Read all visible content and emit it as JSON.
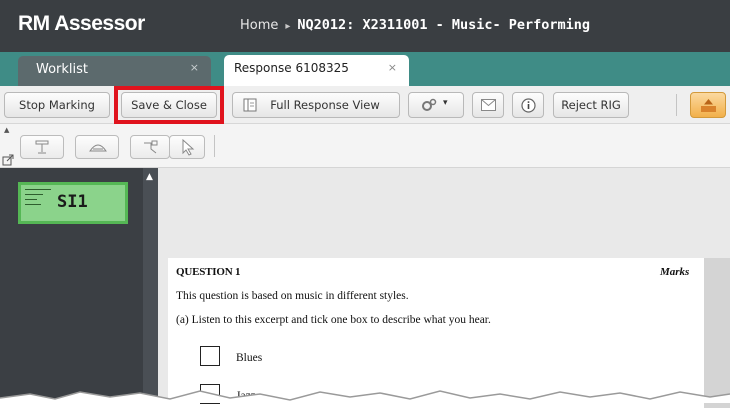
{
  "app": {
    "brand": "RM Assessor"
  },
  "breadcrumb": {
    "home": "Home",
    "separator": "▸",
    "current": "NQ2012: X2311001 - Music- Performing"
  },
  "tabs": [
    {
      "label": "Worklist",
      "close": "×"
    },
    {
      "label": "Response 6108325",
      "close": "×"
    }
  ],
  "toolbar": {
    "stop_marking": "Stop Marking",
    "save_close": "Save & Close",
    "full_response_view": "Full Response View",
    "settings_caret": "▾",
    "reject_rig": "Reject RIG"
  },
  "left_panel": {
    "thumbnail_label": "SI1",
    "scroll_up": "▲"
  },
  "document": {
    "question_title": "QUESTION 1",
    "marks_label": "Marks",
    "intro": "This question is based on music in different styles.",
    "part_a": "(a)  Listen to this excerpt and tick one box to describe what you hear.",
    "options": [
      "Blues",
      "Jazz"
    ]
  },
  "colors": {
    "topbar": "#3a3e42",
    "tabstrip": "#3f8c86",
    "highlight": "#e0131d",
    "thumbnail": "#8bd38b"
  }
}
